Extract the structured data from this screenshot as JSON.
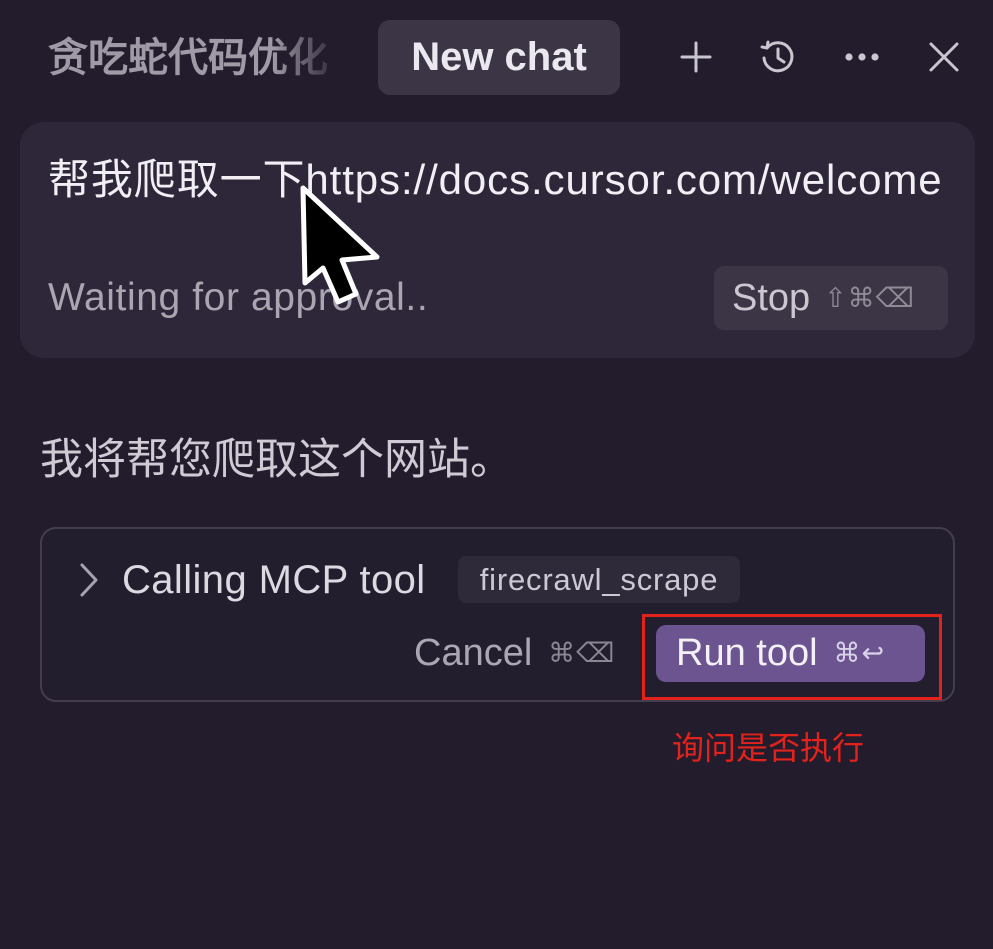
{
  "header": {
    "tabs": [
      {
        "label": "贪吃蛇代码优化",
        "active": false
      },
      {
        "label": "New chat",
        "active": true
      }
    ],
    "action_icons": [
      "plus-icon",
      "history-icon",
      "more-horizontal-icon",
      "close-icon"
    ]
  },
  "composer": {
    "prompt": "帮我爬取一下https://docs.cursor.com/welcome",
    "status": "Waiting for approval..",
    "stop_button": {
      "label": "Stop",
      "shortcut": "⇧⌘⌫"
    }
  },
  "conversation": {
    "assistant_message": "我将帮您爬取这个网站。",
    "tool_call": {
      "expand_icon": "chevron-right-icon",
      "title": "Calling MCP tool",
      "tool_name": "firecrawl_scrape",
      "cancel_button": {
        "label": "Cancel",
        "shortcut": "⌘⌫"
      },
      "run_button": {
        "label": "Run tool",
        "shortcut": "⌘↩"
      }
    }
  },
  "annotation": {
    "note": "询问是否执行"
  },
  "pointer_icon": "mouse-pointer-icon",
  "colors": {
    "background": "#231c2d",
    "panel": "#2e2739",
    "accent": "#6b5490",
    "annotation": "#e3221c"
  }
}
